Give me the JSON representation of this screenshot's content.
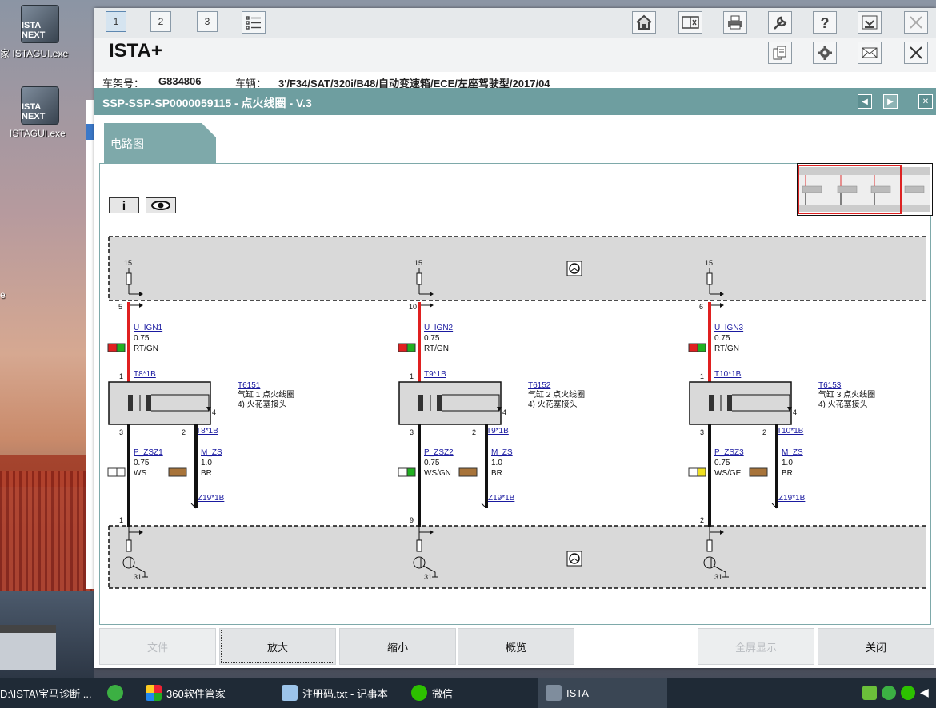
{
  "desktop": {
    "icons": [
      {
        "label": "ISTAGUI.exe",
        "badge": "ISTA NEXT",
        "prefix": "家"
      },
      {
        "label": "ISTAGUI.exe",
        "badge": "ISTA NEXT"
      }
    ],
    "edge_text": "e"
  },
  "toolbar": {
    "tabs": [
      "1",
      "2",
      "3"
    ],
    "icons": [
      "home-icon",
      "split-view-icon",
      "printer-icon",
      "wrench-icon",
      "help-icon",
      "download-icon",
      "close-icon"
    ],
    "row2_icons": [
      "documents-icon",
      "gear-icon",
      "mail-icon",
      "close-icon"
    ]
  },
  "app": {
    "name": "ISTA+"
  },
  "vehicle": {
    "vin_label": "车架号：",
    "vin": "G834806",
    "vehicle_label": "车辆：",
    "vehicle": "3'/F34/SAT/320i/B48/自动变速箱/ECE/左座驾驶型/2017/04"
  },
  "document": {
    "title": "SSP-SSP-SP0000059115 - 点火线圈 - V.3"
  },
  "tab": {
    "label": "电路图"
  },
  "diagram": {
    "top_terminal": "15",
    "bottom_terminal": "31",
    "columns": [
      {
        "pin_top": "5",
        "wire1": "U_IGN1",
        "size1": "0.75",
        "color1": "RT/GN",
        "c1a": "#e02020",
        "c1b": "#20b020",
        "conn_top": "T8*1B",
        "pin1": "1",
        "part": "T6151",
        "desc": "气缸 1 点火线圈",
        "desc2": "4)   火花塞接头",
        "pin3": "3",
        "pin2": "2",
        "conn_right": "T8*1B",
        "wire2": "P_ZSZ1",
        "size2": "0.75",
        "color2": "WS",
        "c2a": "#ffffff",
        "c2b": "#ffffff",
        "wire3": "M_ZS",
        "size3": "1.0",
        "color3": "BR",
        "c3": "#a8743a",
        "ground": "Z19*1B",
        "pin_bottom": "1"
      },
      {
        "pin_top": "10",
        "wire1": "U_IGN2",
        "size1": "0.75",
        "color1": "RT/GN",
        "c1a": "#e02020",
        "c1b": "#20b020",
        "conn_top": "T9*1B",
        "pin1": "1",
        "part": "T6152",
        "desc": "气缸 2 点火线圈",
        "desc2": "4)   火花塞接头",
        "pin3": "3",
        "pin2": "2",
        "conn_right": "T9*1B",
        "wire2": "P_ZSZ2",
        "size2": "0.75",
        "color2": "WS/GN",
        "c2a": "#ffffff",
        "c2b": "#20b020",
        "wire3": "M_ZS",
        "size3": "1.0",
        "color3": "BR",
        "c3": "#a8743a",
        "ground": "Z19*1B",
        "pin_bottom": "9"
      },
      {
        "pin_top": "6",
        "wire1": "U_IGN3",
        "size1": "0.75",
        "color1": "RT/GN",
        "c1a": "#e02020",
        "c1b": "#20b020",
        "conn_top": "T10*1B",
        "pin1": "1",
        "part": "T6153",
        "desc": "气缸 3 点火线圈",
        "desc2": "4)   火花塞接头",
        "pin3": "3",
        "pin2": "2",
        "conn_right": "T10*1B",
        "wire2": "P_ZSZ3",
        "size2": "0.75",
        "color2": "WS/GE",
        "c2a": "#ffffff",
        "c2b": "#f0e020",
        "wire3": "M_ZS",
        "size3": "1.0",
        "color3": "BR",
        "c3": "#a8743a",
        "ground": "Z19*1B",
        "pin_bottom": "2"
      }
    ],
    "coil_pin": "4"
  },
  "buttons": {
    "file": "文件",
    "zoom_in": "放大",
    "zoom_out": "缩小",
    "overview": "概览",
    "fullscreen": "全屏显示",
    "close": "关闭"
  },
  "taskbar": {
    "items": [
      {
        "label": "D:\\ISTA\\宝马诊断 ..."
      },
      {
        "label": ""
      },
      {
        "label": "360软件管家"
      },
      {
        "label": "注册码.txt - 记事本"
      },
      {
        "label": "微信"
      },
      {
        "label": "ISTA"
      }
    ]
  },
  "colors": {
    "teal": "#6e9ea0",
    "wire_red": "#e02020"
  }
}
